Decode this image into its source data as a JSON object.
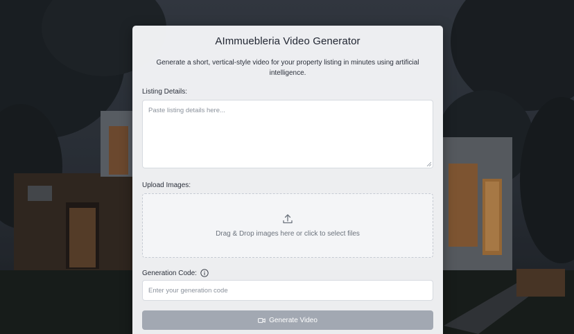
{
  "app": {
    "title": "AImmuebleria Video Generator",
    "description": "Generate a short, vertical-style video for your property listing in minutes using artificial intelligence."
  },
  "listing": {
    "label": "Listing Details:",
    "placeholder": "Paste listing details here..."
  },
  "upload": {
    "label": "Upload Images:",
    "hint": "Drag & Drop images here or click to select files",
    "icon": "upload-icon"
  },
  "generation_code": {
    "label": "Generation Code:",
    "info_icon": "info-icon",
    "placeholder": "Enter your generation code"
  },
  "generate_button": {
    "label": "Generate Video",
    "icon": "video-camera-icon",
    "state": "disabled"
  },
  "colors": {
    "card_background": "#f4f5f7",
    "button_disabled": "#a2a8b2",
    "text_primary": "#1f2430",
    "text_muted": "#8b929c"
  }
}
